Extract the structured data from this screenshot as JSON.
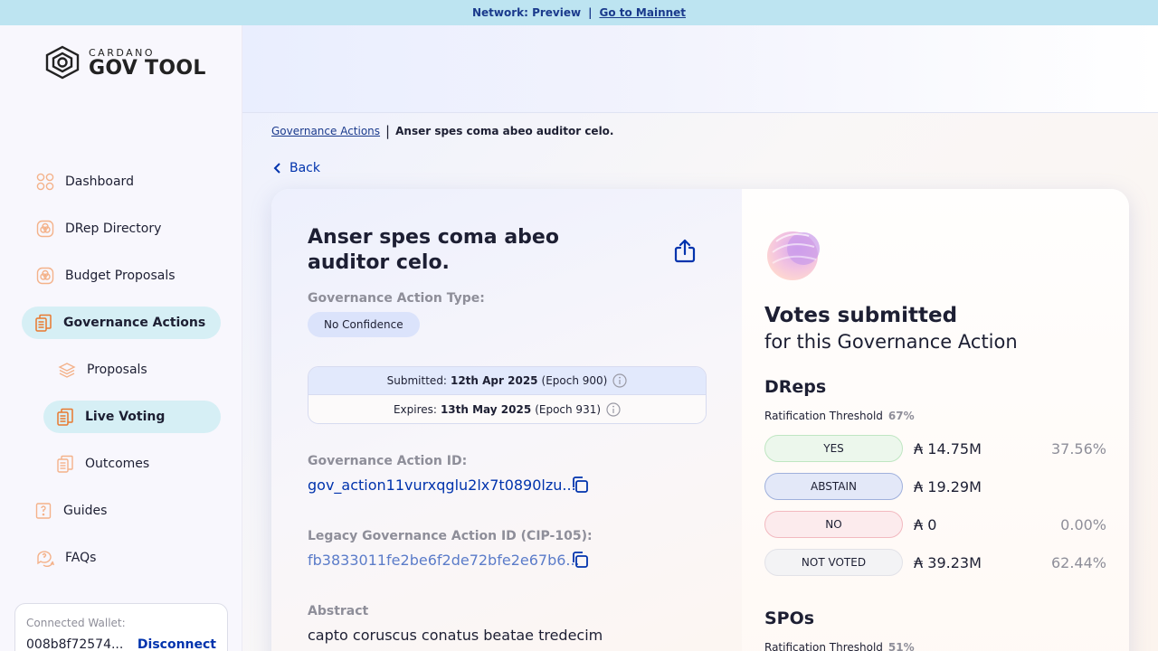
{
  "network": {
    "label": "Network: Preview",
    "separator": "|",
    "link": "Go to Mainnet"
  },
  "logo": {
    "line1": "CARDANO",
    "line2": "GOV TOOL"
  },
  "sidebar": {
    "items": [
      {
        "label": "Dashboard",
        "icon": "dashboard-icon"
      },
      {
        "label": "DRep Directory",
        "icon": "drep-directory-icon"
      },
      {
        "label": "Budget Proposals",
        "icon": "budget-proposals-icon"
      },
      {
        "label": "Governance Actions",
        "icon": "governance-actions-icon",
        "active": true
      },
      {
        "label": "Proposals",
        "icon": "proposals-icon"
      },
      {
        "label": "Live Voting",
        "icon": "live-voting-icon",
        "active": true
      },
      {
        "label": "Outcomes",
        "icon": "outcomes-icon"
      },
      {
        "label": "Guides",
        "icon": "guides-icon"
      },
      {
        "label": "FAQs",
        "icon": "faqs-icon"
      }
    ]
  },
  "wallet": {
    "label": "Connected Wallet:",
    "address": "008b8f72574...",
    "disconnect": "Disconnect"
  },
  "breadcrumb": {
    "parent": "Governance Actions",
    "current": "Anser spes coma abeo auditor celo."
  },
  "back_label": "Back",
  "action": {
    "title": "Anser spes coma abeo auditor celo.",
    "type_label": "Governance Action Type:",
    "type_value": "No Confidence",
    "submitted_prefix": "Submitted:",
    "submitted_date": "12th Apr 2025",
    "submitted_epoch": "(Epoch 900)",
    "expires_prefix": "Expires:",
    "expires_date": "13th May 2025",
    "expires_epoch": "(Epoch 931)",
    "id_label": "Governance Action ID:",
    "id_value": "gov_action11vurxqglu2lx7t0890lzu...",
    "legacy_label": "Legacy Governance Action ID (CIP-105):",
    "legacy_value": "fb3833011fe2be6f2de72bfe2e67b6...",
    "abstract_label": "Abstract",
    "abstract_value": "capto coruscus conatus beatae tredecim"
  },
  "votes": {
    "heading": "Votes submitted",
    "subheading": "for this Governance Action",
    "dreps": {
      "title": "DReps",
      "threshold_label": "Ratification Threshold",
      "threshold_value": "67%",
      "rows": [
        {
          "label": "YES",
          "amount": "₳ 14.75M",
          "percent": "37.56%"
        },
        {
          "label": "ABSTAIN",
          "amount": "₳ 19.29M",
          "percent": ""
        },
        {
          "label": "NO",
          "amount": "₳ 0",
          "percent": "0.00%"
        },
        {
          "label": "NOT VOTED",
          "amount": "₳ 39.23M",
          "percent": "62.44%"
        }
      ]
    },
    "spos": {
      "title": "SPOs",
      "threshold_label": "Ratification Threshold",
      "threshold_value": "51%"
    }
  },
  "colors": {
    "accent": "#0033ad",
    "active_nav": "#d6eff5",
    "banner": "#bde4f1"
  }
}
